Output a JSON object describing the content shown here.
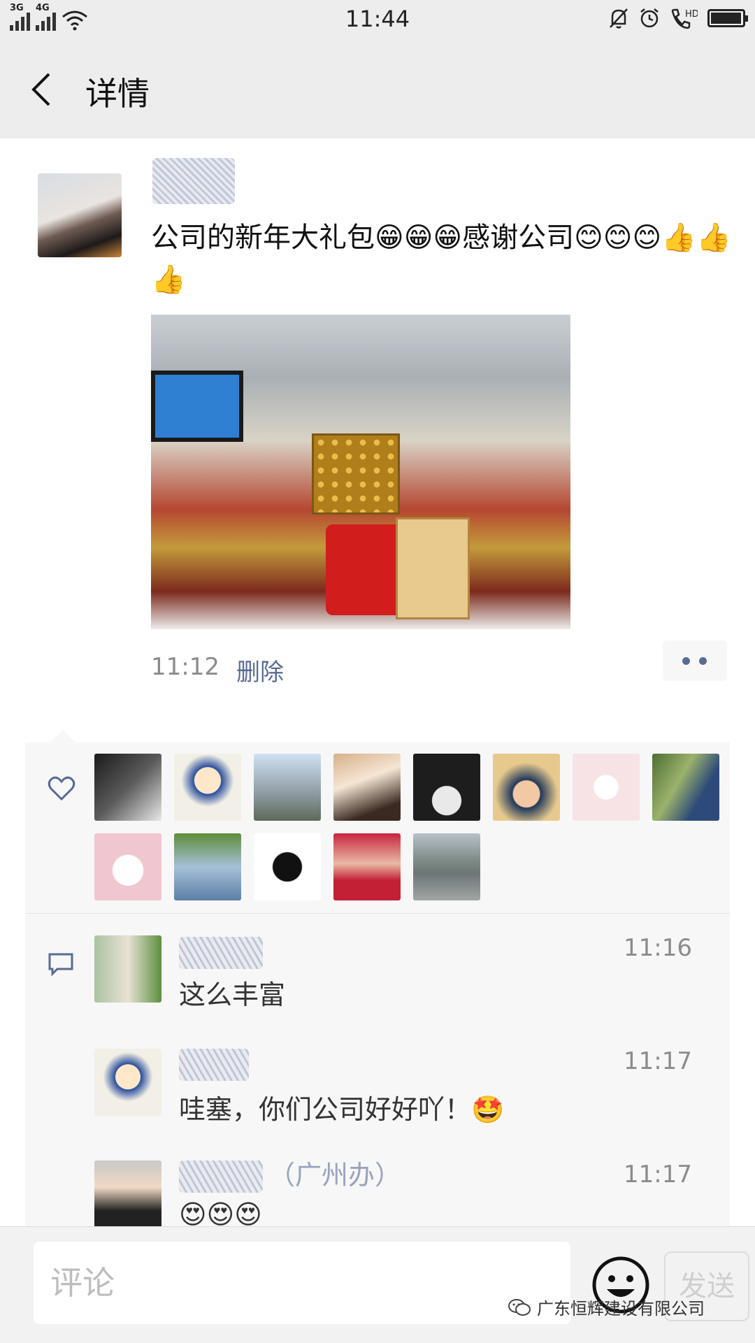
{
  "status_bar": {
    "time": "11:44",
    "signal_1_label": "3G",
    "signal_2_label": "4G",
    "icons": [
      "signal-3g-icon",
      "signal-4g-icon",
      "wifi-icon",
      "mute-bell-icon",
      "alarm-icon",
      "hd-call-icon",
      "battery-icon"
    ],
    "battery_level": 0.9
  },
  "nav": {
    "title": "详情",
    "back_icon": "chevron-left-icon"
  },
  "post": {
    "text": "公司的新年大礼包😁😁😁感谢公司😊😊😊👍👍👍",
    "time": "11:12",
    "delete_label": "删除",
    "more_icon": "more-dots-icon"
  },
  "likes": {
    "icon": "heart-icon",
    "count": 13
  },
  "comments": {
    "icon": "comment-icon",
    "items": [
      {
        "time": "11:16",
        "text": "这么丰富"
      },
      {
        "time": "11:17",
        "text": "哇塞，你们公司好好吖！🤩"
      },
      {
        "time": "11:17",
        "name_suffix": "（广州办）",
        "text": "😍😍😍"
      }
    ]
  },
  "composer": {
    "placeholder": "评论",
    "send_label": "发送",
    "emoji_icon": "emoji-smile-icon"
  },
  "watermark": {
    "text": "广东恒辉建设有限公司",
    "icon": "wechat-icon"
  },
  "colors": {
    "link": "#576b95",
    "meta": "#8b8b8b",
    "header_bg": "#ededed",
    "panel_bg": "#f7f7f7"
  }
}
